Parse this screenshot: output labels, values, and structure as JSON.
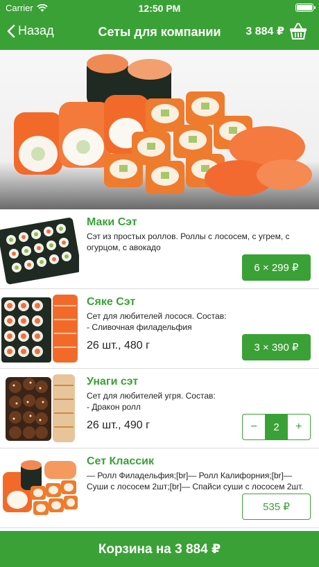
{
  "status_bar": {
    "carrier": "Carrier",
    "time": "12:50 PM"
  },
  "nav": {
    "back_label": "Назад",
    "title": "Сеты для компании",
    "cart_total": "3 884 ₽"
  },
  "colors": {
    "brand": "#3aa136",
    "text": "#222222",
    "divider": "#dcdcdc"
  },
  "products": [
    {
      "title": "Маки Сэт",
      "description": "Сэт из простых роллов. Роллы с лососем, с угрем, с огурцом, с авокадо",
      "meta": "",
      "action": {
        "type": "button",
        "label": "6 × 299 ₽"
      }
    },
    {
      "title": "Сяке Сэт",
      "description": "Сет для любителей лосося. Состав:\n- Сливочная филадельфия",
      "meta": "26 шт., 480 г",
      "action": {
        "type": "button",
        "label": "3 × 390 ₽"
      }
    },
    {
      "title": "Унаги сэт",
      "description": "Сет для любителей угря. Состав:\n- Дракон ролл",
      "meta": "26 шт., 490 г",
      "action": {
        "type": "stepper",
        "minus": "−",
        "value": "2",
        "plus": "+"
      }
    },
    {
      "title": "Сет Классик",
      "description": "— Ролл Филадельфия;[br]— Ролл Калифорния;[br]— Суши с лососем 2шт;[br]— Спайси суши с лососем 2шт.",
      "meta": "",
      "action": {
        "type": "outline",
        "label": "535 ₽"
      }
    }
  ],
  "bottom_bar": {
    "label": "Корзина на 3 884 ₽"
  }
}
